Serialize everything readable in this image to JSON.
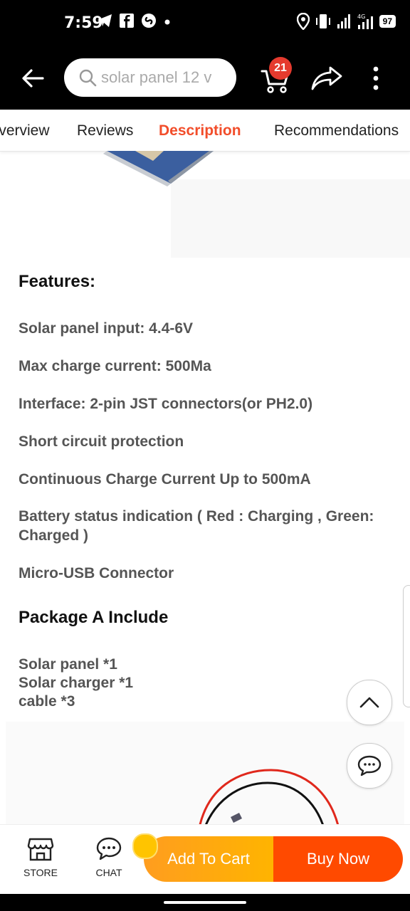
{
  "status_bar": {
    "time": "7:59",
    "battery": "97",
    "network": "4G"
  },
  "search": {
    "placeholder": "solar panel 12 v"
  },
  "cart": {
    "badge_count": "21"
  },
  "tabs": [
    {
      "label": "Overview"
    },
    {
      "label": "Reviews"
    },
    {
      "label": "Description",
      "active": true
    },
    {
      "label": "Recommendations"
    }
  ],
  "description": {
    "features_heading": "Features:",
    "features": [
      "Solar panel input: 4.4-6V",
      "Max charge current: 500Ma",
      "Interface: 2-pin JST connectors(or PH2.0)",
      "Short circuit protection",
      "Continuous Charge Current Up to 500mA",
      "Battery status indication ( Red : Charging , Green: Charged )",
      "Micro-USB Connector"
    ],
    "package_heading": "Package A Include",
    "package_items": [
      "Solar panel *1",
      "Solar charger *1",
      "cable *3"
    ]
  },
  "bottom_bar": {
    "store_label": "STORE",
    "chat_label": "CHAT",
    "add_to_cart_label": "Add To Cart",
    "buy_now_label": "Buy Now"
  },
  "colors": {
    "accent": "#f24d2a",
    "add_to_cart": "#ffa51a",
    "buy_now": "#ff4a00",
    "badge": "#e53a2e"
  }
}
